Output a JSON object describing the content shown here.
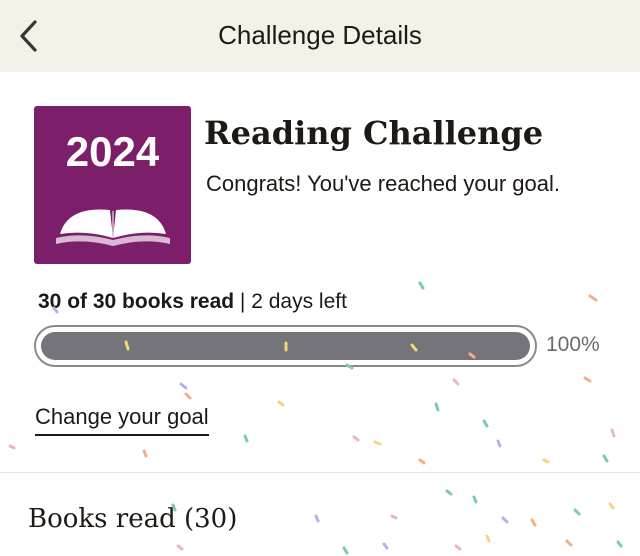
{
  "header": {
    "title": "Challenge Details",
    "back_icon": "chevron-left-icon"
  },
  "badge": {
    "year": "2024",
    "icon": "open-book-icon",
    "background": "#7c1e69"
  },
  "challenge": {
    "title": "Reading Challenge",
    "message": "Congrats! You've reached your goal."
  },
  "progress": {
    "books_read_text": "30 of 30 books read",
    "separator": " | ",
    "days_left_text": "2 days left",
    "percent_label": "100%",
    "fraction": 1.0,
    "bar_color": "#74747a"
  },
  "actions": {
    "change_goal_label": "Change your goal"
  },
  "section": {
    "books_read_title": "Books read (30)"
  },
  "colors": {
    "header_bg": "#f4f1e8",
    "text": "#1e1915"
  }
}
